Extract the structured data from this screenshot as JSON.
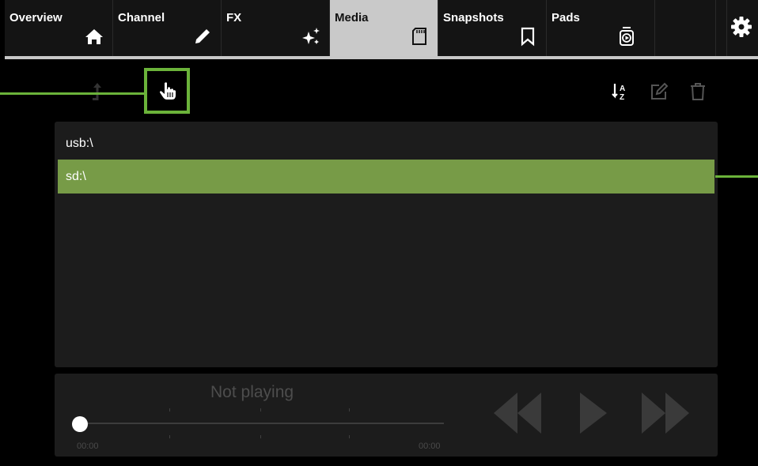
{
  "tabs": [
    {
      "label": "Overview",
      "icon": "home-icon"
    },
    {
      "label": "Channel",
      "icon": "pencil-icon"
    },
    {
      "label": "FX",
      "icon": "sparkle-icon"
    },
    {
      "label": "Media",
      "icon": "sd-card-icon",
      "active": true
    },
    {
      "label": "Snapshots",
      "icon": "bookmark-icon"
    },
    {
      "label": "Pads",
      "icon": "pad-icon"
    }
  ],
  "settings": {
    "icon": "gear-icon"
  },
  "toolbar": {
    "up_icon": "folder-up-icon",
    "select_icon": "hand-pointer-icon",
    "sort_icon": "sort-az-icon",
    "rename_icon": "edit-icon",
    "delete_icon": "trash-icon"
  },
  "files": [
    {
      "name": "usb:\\",
      "selected": false
    },
    {
      "name": "sd:\\",
      "selected": true
    }
  ],
  "player": {
    "status": "Not playing",
    "elapsed": "00:00",
    "total": "00:00",
    "progress": 0
  },
  "colors": {
    "accent": "#6bb33a",
    "selected_row": "#779b47",
    "active_tab": "#c9c9c9"
  }
}
